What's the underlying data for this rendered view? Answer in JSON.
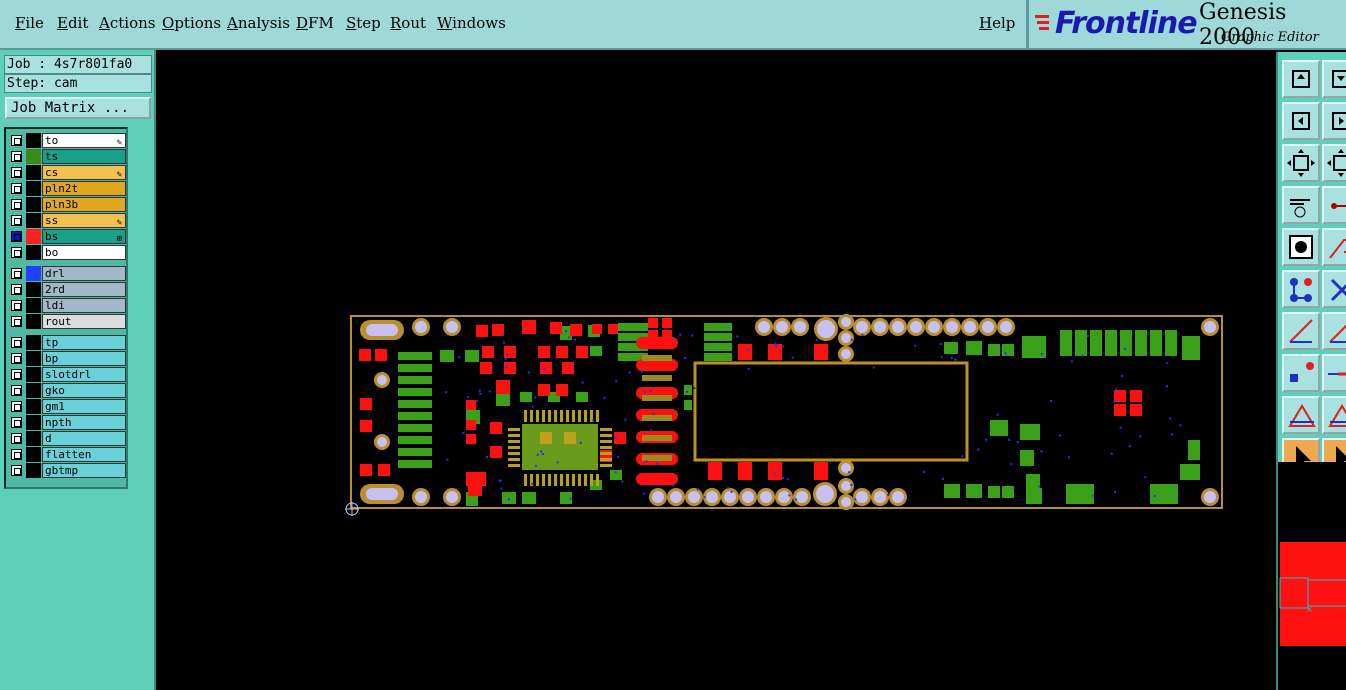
{
  "menu": {
    "items": [
      "File",
      "Edit",
      "Actions",
      "Options",
      "Analysis",
      "DFM",
      "Step",
      "Rout",
      "Windows"
    ],
    "help": "Help"
  },
  "brand": {
    "logo": "Frontline",
    "product": "Genesis 2000",
    "subtitle": "Graphic Editor"
  },
  "panel": {
    "job": "Job : 4s7r801fa0",
    "step": "Step: cam",
    "job_matrix": "Job Matrix ..."
  },
  "layers": {
    "group1": [
      {
        "name": "to",
        "swatch": "#000000",
        "bg": "#ffffff",
        "flag": "✎"
      },
      {
        "name": "ts",
        "swatch": "#3a8a1a",
        "bg": "#1aa08a",
        "flag": ""
      },
      {
        "name": "cs",
        "swatch": "#000000",
        "bg": "#f0c050",
        "flag": "✎"
      },
      {
        "name": "pln2t",
        "swatch": "#000000",
        "bg": "#e0a820",
        "flag": ""
      },
      {
        "name": "pln3b",
        "swatch": "#000000",
        "bg": "#e0a820",
        "flag": ""
      },
      {
        "name": "ss",
        "swatch": "#000000",
        "bg": "#f0c050",
        "flag": "✎"
      },
      {
        "name": "bs",
        "swatch": "#ff2020",
        "bg": "#1aa08a",
        "flag": "⊞"
      },
      {
        "name": "bo",
        "swatch": "#000000",
        "bg": "#ffffff",
        "flag": ""
      }
    ],
    "group2": [
      {
        "name": "drl",
        "swatch": "#2040ff",
        "bg": "#a0b8c8"
      },
      {
        "name": "2rd",
        "swatch": "#000000",
        "bg": "#a0b8c8"
      },
      {
        "name": "ldi",
        "swatch": "#000000",
        "bg": "#a0b8c8"
      },
      {
        "name": "rout",
        "swatch": "#000000",
        "bg": "#dcdcdc"
      }
    ],
    "group3": [
      {
        "name": "tp",
        "swatch": "#000000",
        "bg": "#6ad0d8"
      },
      {
        "name": "bp",
        "swatch": "#000000",
        "bg": "#6ad0d8"
      },
      {
        "name": "slotdrl",
        "swatch": "#000000",
        "bg": "#6ad0d8"
      },
      {
        "name": "gko",
        "swatch": "#000000",
        "bg": "#6ad0d8"
      },
      {
        "name": "gm1",
        "swatch": "#000000",
        "bg": "#6ad0d8"
      },
      {
        "name": "npth",
        "swatch": "#000000",
        "bg": "#6ad0d8"
      },
      {
        "name": "d",
        "swatch": "#000000",
        "bg": "#6ad0d8"
      },
      {
        "name": "flatten",
        "swatch": "#000000",
        "bg": "#6ad0d8"
      },
      {
        "name": "gbtmp",
        "swatch": "#000000",
        "bg": "#6ad0d8"
      }
    ]
  },
  "colors": {
    "menubar": "#9ed8d8",
    "panel": "#5ecfb8",
    "board_outline": "#b89030",
    "pad_red": "#ff1010",
    "pad_green": "#3aa01a",
    "via_lavender": "#c8c0f0",
    "drill_blue": "#2030ff"
  }
}
